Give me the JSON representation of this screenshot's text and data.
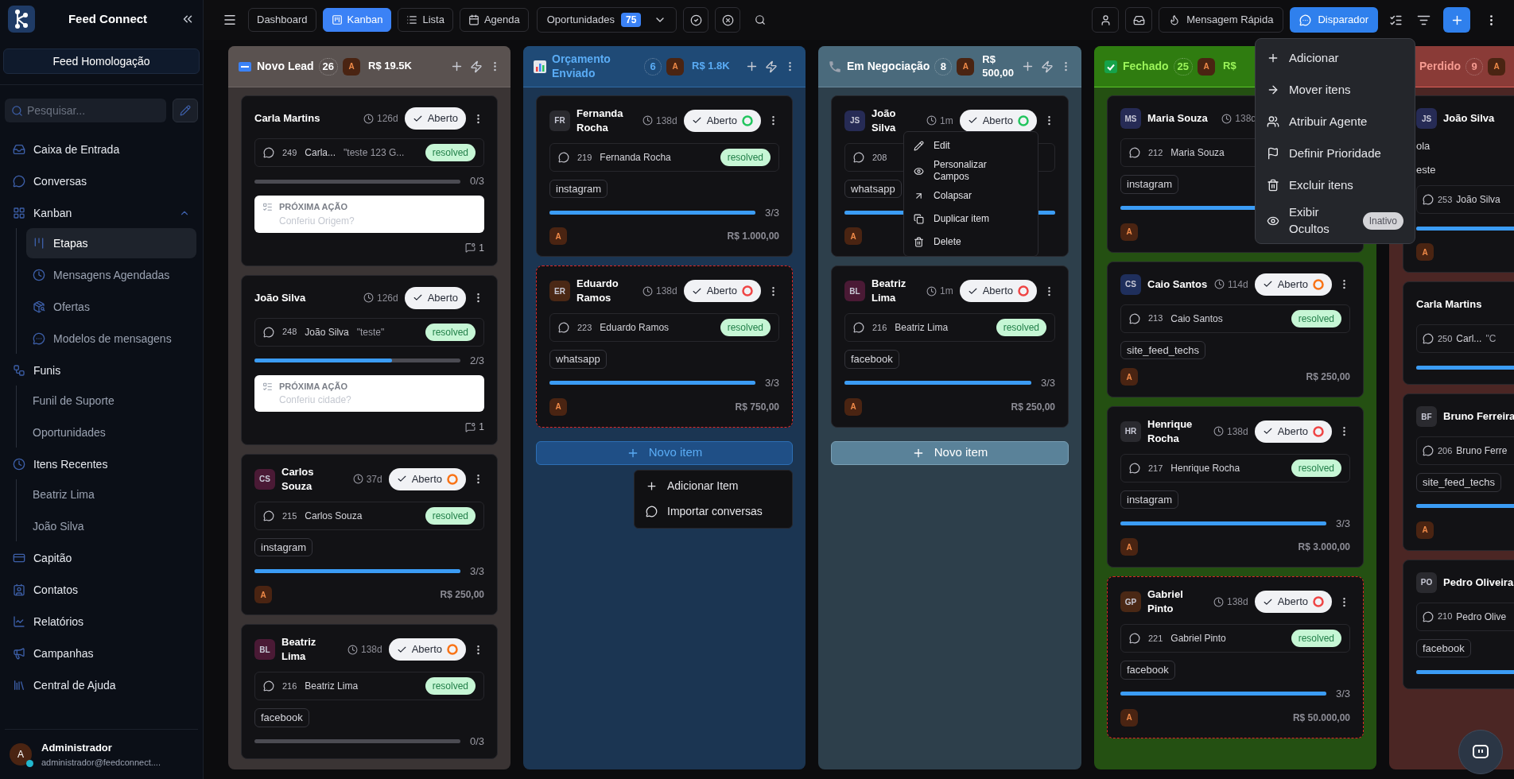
{
  "sidebar": {
    "brand": "Feed Connect",
    "workspace": "Feed Homologação",
    "search": {
      "placeholder": "Pesquisar..."
    },
    "nav": [
      {
        "label": "Caixa de Entrada",
        "kind": "inbox",
        "selected": false
      },
      {
        "label": "Conversas",
        "kind": "chat",
        "selected": false
      },
      {
        "label": "Kanban",
        "kind": "kanban",
        "selected": false,
        "expanded": true,
        "children": [
          {
            "label": "Etapas",
            "kind": "stages",
            "selected": true
          },
          {
            "label": "Mensagens Agendadas",
            "kind": "schedule",
            "selected": false
          },
          {
            "label": "Ofertas",
            "kind": "offers",
            "selected": false
          },
          {
            "label": "Modelos de mensagens",
            "kind": "templates",
            "selected": false
          }
        ]
      },
      {
        "label": "Funis",
        "kind": "funnels",
        "selected": false,
        "children": [
          {
            "label": "Funil de Suporte",
            "selected": false
          },
          {
            "label": "Oportunidades",
            "selected": false
          }
        ]
      },
      {
        "label": "Itens Recentes",
        "kind": "recent",
        "selected": false,
        "children": [
          {
            "label": "Beatriz Lima",
            "selected": false
          },
          {
            "label": "João Silva",
            "selected": false
          }
        ]
      },
      {
        "label": "Capitão",
        "kind": "captain",
        "selected": false
      },
      {
        "label": "Contatos",
        "kind": "contacts",
        "selected": false
      },
      {
        "label": "Relatórios",
        "kind": "reports",
        "selected": false
      },
      {
        "label": "Campanhas",
        "kind": "campaigns",
        "selected": false
      },
      {
        "label": "Central de Ajuda",
        "kind": "help",
        "selected": false
      }
    ],
    "user": {
      "initial": "A",
      "name": "Administrador",
      "email": "administrador@feedconnect....",
      "online": true
    }
  },
  "toolbar": {
    "tabs": [
      {
        "label": "Dashboard",
        "kind": "dashboard",
        "selected": false
      },
      {
        "label": "Kanban",
        "kind": "kanban",
        "selected": true
      },
      {
        "label": "Lista",
        "kind": "list",
        "selected": false
      },
      {
        "label": "Agenda",
        "kind": "calendar",
        "selected": false
      }
    ],
    "pipeline": {
      "label": "Oportunidades",
      "count": "75"
    },
    "quick_message": "Mensagem Rápida",
    "dispatcher": "Disparador"
  },
  "columns": [
    {
      "title": "Novo Lead",
      "kind": "new",
      "count": "26",
      "owner": "A",
      "total": "R$ 19.5K",
      "tools": true,
      "cards": [
        {
          "name": "Carla Martins",
          "age": "126d",
          "status": "Aberto",
          "overdue": false,
          "conversation": {
            "id": "249",
            "contact": "Carla...",
            "preview": "\"teste 123 G...",
            "status": "resolved"
          },
          "progress": {
            "level": 0,
            "count": "0/3"
          },
          "next_action": {
            "label": "PRÓXIMA AÇÃO",
            "text": "Conferiu Origem?"
          },
          "comments": "1"
        },
        {
          "name": "João Silva",
          "age": "126d",
          "status": "Aberto",
          "overdue": false,
          "conversation": {
            "id": "248",
            "contact": "João Silva",
            "preview": "\"teste\"",
            "status": "resolved"
          },
          "progress": {
            "level": 0.667,
            "count": "2/3"
          },
          "next_action": {
            "label": "PRÓXIMA AÇÃO",
            "text": "Conferiu cidade?"
          },
          "comments": "1"
        },
        {
          "name": "Carlos Souza",
          "avatar": {
            "initials": "CS",
            "color": "#4a1a35"
          },
          "age": "37d",
          "status": "Aberto",
          "timer": {
            "color": "#f97316"
          },
          "overdue": false,
          "conversation": {
            "id": "215",
            "contact": "Carlos Souza",
            "status": "resolved"
          },
          "tag": "instagram",
          "progress": {
            "level": 1,
            "count": "3/3"
          },
          "owner": "A",
          "value": "R$ 250,00"
        },
        {
          "name": "Beatriz Lima",
          "avatar": {
            "initials": "BL",
            "color": "#4a1a35"
          },
          "age": "138d",
          "status": "Aberto",
          "timer": {
            "color": "#f97316"
          },
          "overdue": false,
          "conversation": {
            "id": "216",
            "contact": "Beatriz Lima",
            "status": "resolved"
          },
          "tag": "facebook",
          "progress": {
            "level": 0,
            "count": "0/3"
          }
        }
      ]
    },
    {
      "title": "Orçamento Enviado",
      "kind": "quote",
      "count": "6",
      "owner": "A",
      "total": "R$ 1.8K",
      "tools": true,
      "add_button": "Novo item",
      "add_menu": [
        {
          "label": "Adicionar Item",
          "kind": "add"
        },
        {
          "label": "Importar conversas",
          "kind": "chat"
        }
      ],
      "cards": [
        {
          "name": "Fernanda Rocha",
          "avatar": {
            "initials": "FR",
            "color": "#2a2a2f"
          },
          "age": "138d",
          "status": "Aberto",
          "timer": {
            "color": "#22c55e"
          },
          "overdue": false,
          "conversation": {
            "id": "219",
            "contact": "Fernanda Rocha",
            "status": "resolved"
          },
          "tag": "instagram",
          "progress": {
            "level": 1,
            "count": "3/3"
          },
          "owner": "A",
          "value": "R$ 1.000,00"
        },
        {
          "name": "Eduardo Ramos",
          "avatar": {
            "initials": "ER",
            "color": "#4a2815"
          },
          "age": "138d",
          "status": "Aberto",
          "timer": {
            "color": "#ef4444"
          },
          "overdue": true,
          "conversation": {
            "id": "223",
            "contact": "Eduardo Ramos",
            "status": "resolved"
          },
          "tag": "whatsapp",
          "progress": {
            "level": 1,
            "count": "3/3"
          },
          "owner": "A",
          "value": "R$ 750,00"
        }
      ]
    },
    {
      "title": "Em Negociação",
      "kind": "negotiation",
      "count": "8",
      "owner": "A",
      "total": "R$ 500,00",
      "tools": true,
      "add_button": "Novo item",
      "cards": [
        {
          "name": "João Silva",
          "avatar": {
            "initials": "JS",
            "color": "#262b55"
          },
          "age": "1m",
          "status": "Aberto",
          "timer": {
            "color": "#22c55e"
          },
          "overdue": false,
          "conversation": {
            "id": "208"
          },
          "tag": "whatsapp",
          "progress": {
            "level": 1
          },
          "owner": "A",
          "menu": [
            {
              "label": "Edit",
              "kind": "edit"
            },
            {
              "label": "Personalizar Campos",
              "kind": "fields"
            },
            {
              "label": "Colapsar",
              "kind": "collapse"
            },
            {
              "label": "Duplicar item",
              "kind": "duplicate"
            },
            {
              "label": "Delete",
              "kind": "delete"
            }
          ]
        },
        {
          "name": "Beatriz Lima",
          "avatar": {
            "initials": "BL",
            "color": "#4a1a35"
          },
          "age": "1m",
          "status": "Aberto",
          "timer": {
            "color": "#ef4444"
          },
          "overdue": false,
          "conversation": {
            "id": "216",
            "contact": "Beatriz Lima",
            "status": "resolved"
          },
          "tag": "facebook",
          "progress": {
            "level": 1,
            "count": "3/3"
          },
          "owner": "A",
          "value": "R$ 250,00"
        }
      ]
    },
    {
      "title": "Fechado",
      "kind": "won",
      "count": "25",
      "owner": "A",
      "total": "R$",
      "tools": false,
      "cards": [
        {
          "name": "Maria Souza",
          "avatar": {
            "initials": "MS",
            "color": "#262b55"
          },
          "age": "138d",
          "overdue": false,
          "conversation": {
            "id": "212",
            "contact": "Maria Souza"
          },
          "tag": "instagram",
          "progress": {
            "level": 1
          },
          "owner": "A"
        },
        {
          "name": "Caio Santos",
          "avatar": {
            "initials": "CS",
            "color": "#1f2f5c"
          },
          "age": "114d",
          "status": "Aberto",
          "timer": {
            "color": "#f97316"
          },
          "overdue": false,
          "conversation": {
            "id": "213",
            "contact": "Caio Santos",
            "status": "resolved"
          },
          "tag": "site_feed_techs",
          "owner": "A",
          "value": "R$ 250,00"
        },
        {
          "name": "Henrique Rocha",
          "avatar": {
            "initials": "HR",
            "color": "#2a2a2f"
          },
          "age": "138d",
          "status": "Aberto",
          "timer": {
            "color": "#ef4444"
          },
          "overdue": false,
          "conversation": {
            "id": "217",
            "contact": "Henrique Rocha",
            "status": "resolved"
          },
          "tag": "instagram",
          "progress": {
            "level": 1,
            "count": "3/3"
          },
          "owner": "A",
          "value": "R$ 3.000,00"
        },
        {
          "name": "Gabriel Pinto",
          "avatar": {
            "initials": "GP",
            "color": "#4a2815"
          },
          "age": "138d",
          "status": "Aberto",
          "timer": {
            "color": "#ef4444"
          },
          "overdue": true,
          "conversation": {
            "id": "221",
            "contact": "Gabriel Pinto",
            "status": "resolved"
          },
          "tag": "facebook",
          "progress": {
            "level": 1,
            "count": "3/3"
          },
          "owner": "A",
          "value": "R$ 50.000,00"
        }
      ]
    },
    {
      "title": "Perdido",
      "kind": "lost",
      "count": "9",
      "owner": "A",
      "cards": [
        {
          "name": "João Silva",
          "avatar": {
            "initials": "JS",
            "color": "#262b55"
          },
          "overdue": false,
          "lines": [
            "ola",
            "este"
          ],
          "conversation": {
            "id": "253",
            "contact": "João Silva"
          },
          "progress": {
            "level": 1
          },
          "owner": "A"
        },
        {
          "name": "Carla Martins",
          "overdue": false,
          "conversation": {
            "id": "250",
            "contact": "Carl...",
            "preview": "\"C"
          },
          "progress": {
            "level": 1
          }
        },
        {
          "name": "Bruno Ferreira",
          "avatar": {
            "initials": "BF",
            "color": "#2a2a2f"
          },
          "overdue": false,
          "conversation": {
            "id": "206",
            "contact": "Bruno Ferre"
          },
          "tag": "site_feed_techs",
          "progress": {
            "level": 1
          },
          "owner": "A"
        },
        {
          "name": "Pedro Oliveira",
          "avatar": {
            "initials": "PO",
            "color": "#2a2a2f"
          },
          "overdue": false,
          "conversation": {
            "id": "210",
            "contact": "Pedro Olive"
          },
          "tag": "facebook",
          "progress": {
            "level": 1
          }
        }
      ]
    }
  ],
  "board_menu": [
    {
      "label": "Adicionar",
      "kind": "add"
    },
    {
      "label": "Mover itens",
      "kind": "move"
    },
    {
      "label": "Atribuir Agente",
      "kind": "assign"
    },
    {
      "label": "Definir Prioridade",
      "kind": "priority"
    },
    {
      "label": "Excluir itens",
      "kind": "delete"
    },
    {
      "label": "Exibir Ocultos",
      "kind": "hidden",
      "badge": "Inativo"
    }
  ]
}
